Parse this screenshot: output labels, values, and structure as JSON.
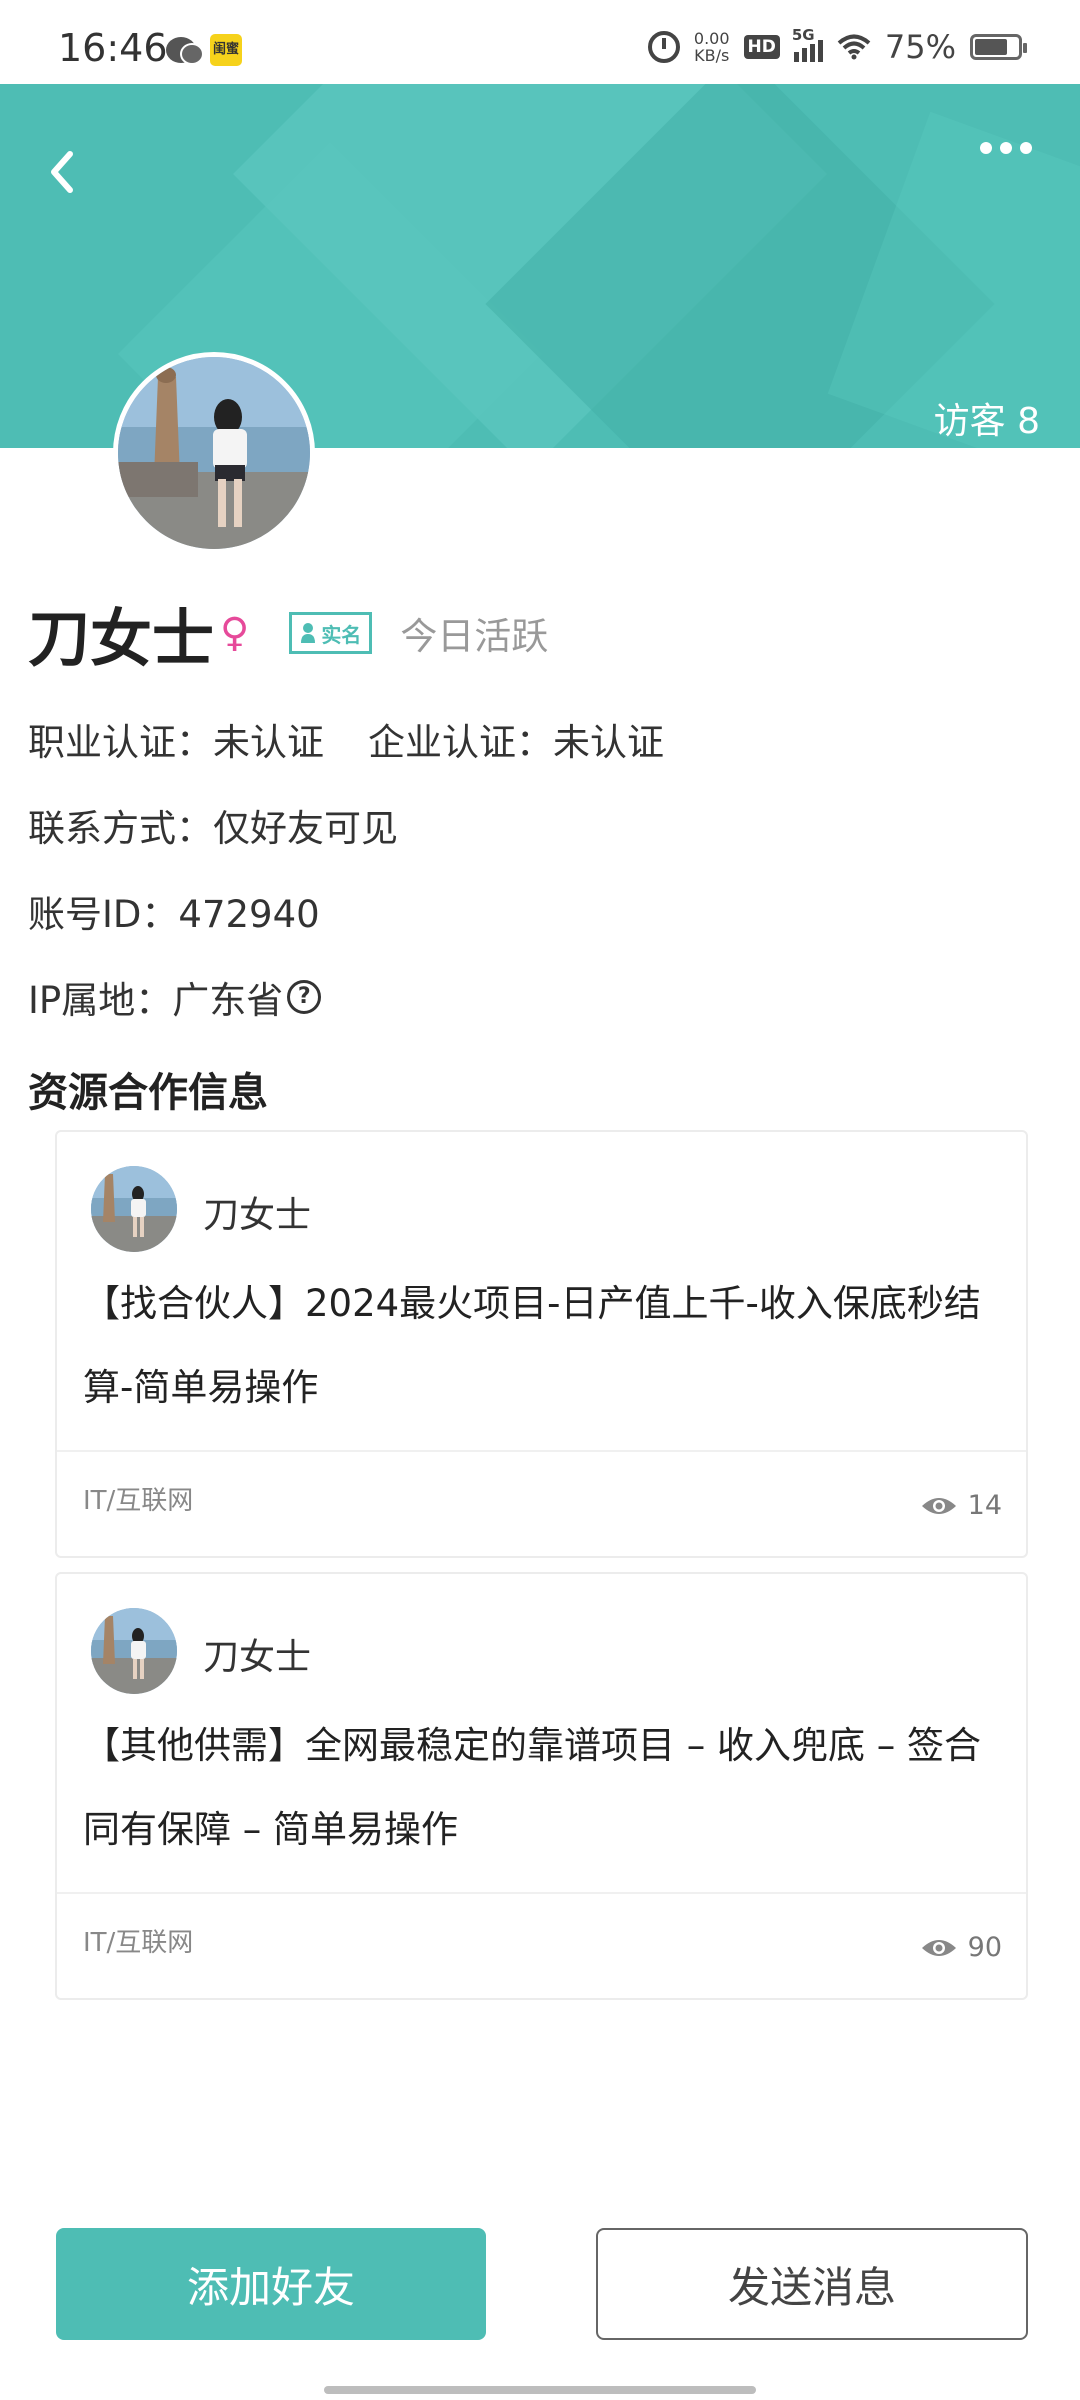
{
  "status_bar": {
    "time": "16:46",
    "app_badge": "闺蜜",
    "net_speed_value": "0.00",
    "net_speed_unit": "KB/s",
    "hd": "HD",
    "network": "5G",
    "battery_pct": "75%"
  },
  "header": {
    "visitors": "访客 8",
    "accent_color": "#4ebdb4"
  },
  "profile": {
    "name": "刀女士",
    "gender_symbol": "♀",
    "verified_label": "实名",
    "activity": "今日活跃",
    "career_cert": "职业认证：未认证",
    "company_cert": "企业认证：未认证",
    "contact": "联系方式：仅好友可见",
    "account_id": "账号ID：472940",
    "ip_location": "IP属地：广东省",
    "ip_help_icon": "?"
  },
  "section": {
    "title": "资源合作信息"
  },
  "posts": [
    {
      "author": "刀女士",
      "title": "【找合伙人】2024最火项目-日产值上千-收入保底秒结算-简单易操作",
      "tag": "IT/互联网",
      "views": "14"
    },
    {
      "author": "刀女士",
      "title": "【其他供需】全网最稳定的靠谱项目 – 收入兜底 – 签合同有保障 – 简单易操作",
      "tag": "IT/互联网",
      "views": "90"
    }
  ],
  "actions": {
    "add_friend": "添加好友",
    "send_message": "发送消息"
  }
}
